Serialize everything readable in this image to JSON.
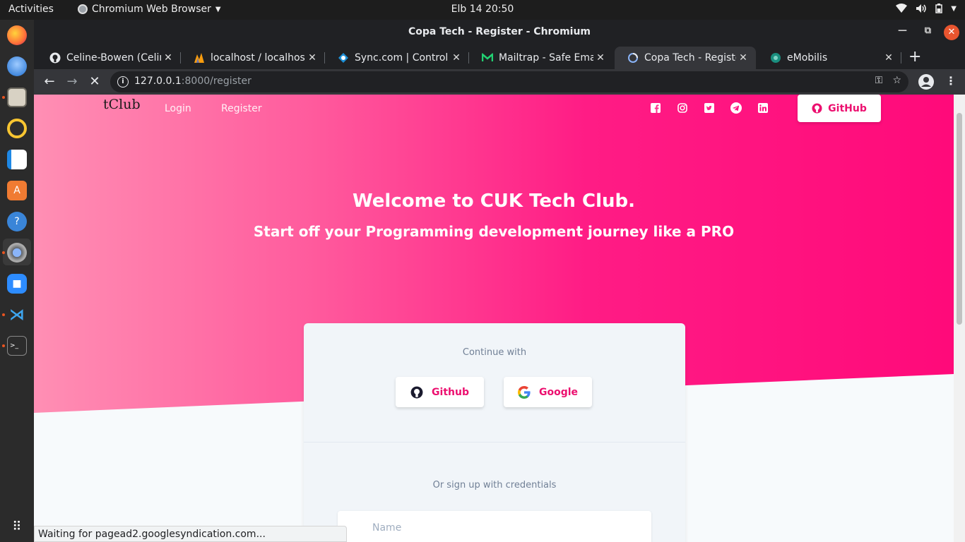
{
  "topbar": {
    "activities": "Activities",
    "app_name": "Chromium Web Browser",
    "clock": "Elb 14  20:50"
  },
  "window": {
    "title": "Copa Tech - Register - Chromium"
  },
  "tabs": [
    {
      "label": "Celine-Bowen (Celine",
      "icon": "github-icon"
    },
    {
      "label": "localhost / localhost",
      "icon": "phpmyadmin-icon"
    },
    {
      "label": "Sync.com | Control Pa",
      "icon": "sync-icon"
    },
    {
      "label": "Mailtrap - Safe Email",
      "icon": "mailtrap-icon"
    },
    {
      "label": "Copa Tech - Register",
      "icon": "loading-icon"
    },
    {
      "label": "eMobilis",
      "icon": "emobilis-icon"
    }
  ],
  "address": {
    "host": "127.0.0.1",
    "path": ":8000/register"
  },
  "page": {
    "brand": "tClub",
    "nav": {
      "login": "Login",
      "register": "Register"
    },
    "github_button": "GitHub",
    "heading": "Welcome to CUK Tech Club.",
    "subheading": "Start off your Programming development journey like a PRO",
    "card": {
      "continue_with": "Continue with",
      "github": "Github",
      "google": "Google",
      "or_credentials": "Or sign up with credentials",
      "name_placeholder": "Name"
    }
  },
  "status_bar": "Waiting for pagead2.googlesyndication.com...",
  "colors": {
    "accent": "#ec0f6f",
    "hero_start": "#ff8fb4",
    "hero_end": "#ff0a7a"
  }
}
